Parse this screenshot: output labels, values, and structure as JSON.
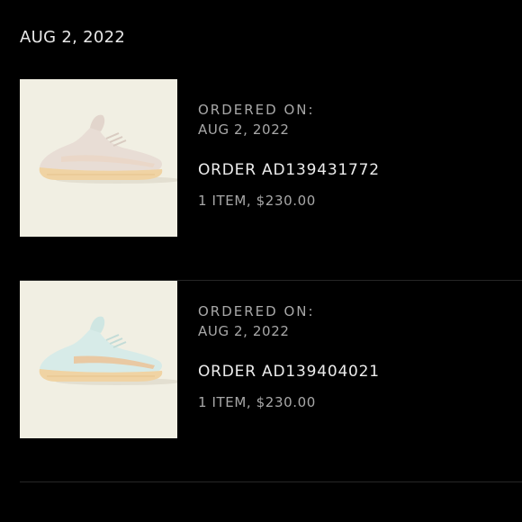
{
  "group_date": "AUG 2, 2022",
  "orders": [
    {
      "ordered_on_label": "ORDERED ON:",
      "ordered_on_date": "AUG 2, 2022",
      "order_number": "ORDER AD139431772",
      "summary": "1 ITEM, $230.00",
      "shoe_colors": {
        "upper": "#e8ddd5",
        "sole": "#f0d3a3",
        "stripe": "#ead7c8"
      }
    },
    {
      "ordered_on_label": "ORDERED ON:",
      "ordered_on_date": "AUG 2, 2022",
      "order_number": "ORDER AD139404021",
      "summary": "1 ITEM, $230.00",
      "shoe_colors": {
        "upper": "#d7ebe8",
        "sole": "#f0d3a3",
        "stripe": "#e9c9a3"
      }
    }
  ],
  "colors": {
    "background": "#000000",
    "thumbnail_bg": "#f1efe3",
    "muted_text": "#a8a8a8",
    "primary_text": "#ececec"
  }
}
